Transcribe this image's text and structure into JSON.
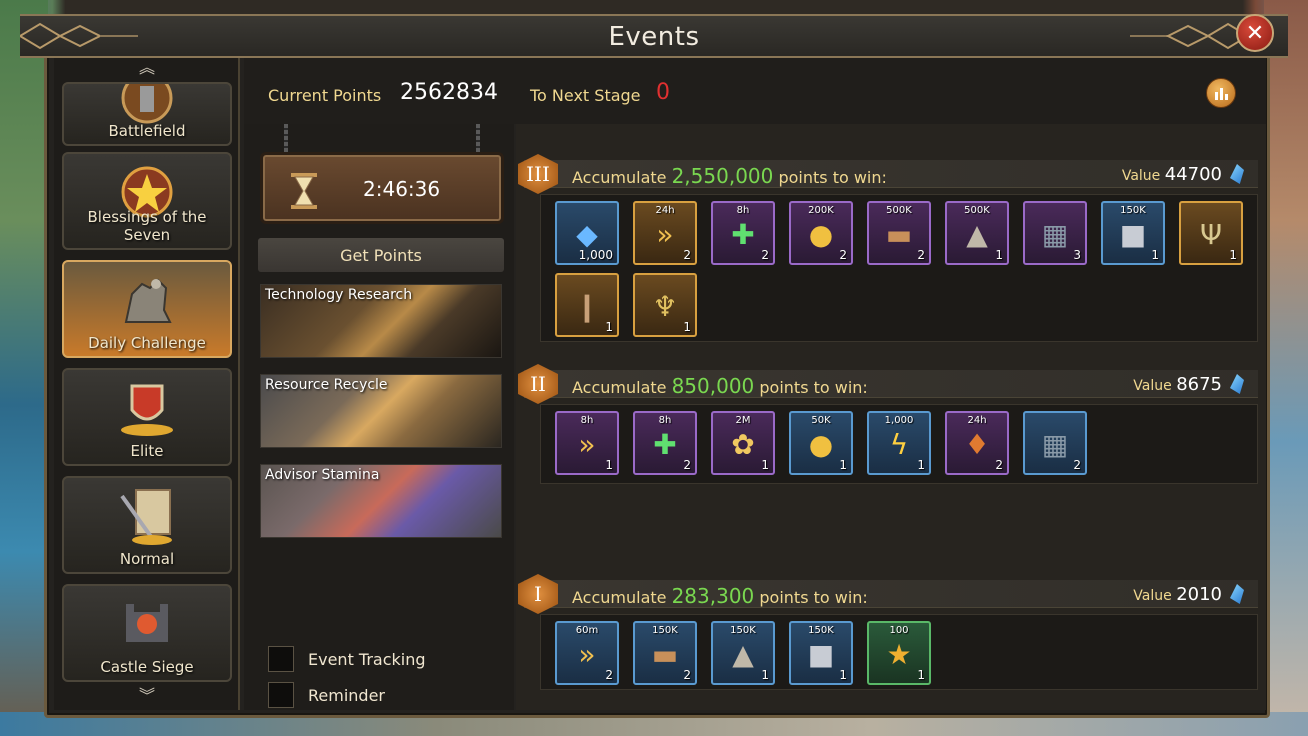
{
  "window": {
    "title": "Events"
  },
  "sidebar": {
    "items": [
      {
        "label": "Battlefield",
        "icon": "battlefield-icon",
        "active": false
      },
      {
        "label": "Blessings of the Seven",
        "icon": "blessings-icon",
        "active": false
      },
      {
        "label": "Daily Challenge",
        "icon": "knight-horse-icon",
        "active": true
      },
      {
        "label": "Elite",
        "icon": "shield-gold-icon",
        "active": false
      },
      {
        "label": "Normal",
        "icon": "scroll-sword-icon",
        "active": false
      },
      {
        "label": "Castle Siege",
        "icon": "castle-siege-icon",
        "active": false
      }
    ]
  },
  "header": {
    "current_points_label": "Current Points",
    "current_points_value": "2562834",
    "next_stage_label": "To Next Stage",
    "next_stage_value": "0"
  },
  "timer": {
    "value": "2:46:36"
  },
  "get_points": {
    "label": "Get Points",
    "sources": [
      {
        "label": "Technology Research"
      },
      {
        "label": "Resource Recycle"
      },
      {
        "label": "Advisor Stamina"
      }
    ]
  },
  "options": {
    "event_tracking": "Event Tracking",
    "reminder": "Reminder"
  },
  "tiers": [
    {
      "numeral": "III",
      "prefix": "Accumulate ",
      "points": "2,550,000",
      "suffix": " points to win:",
      "value_label": "Value",
      "value": "44700",
      "items": [
        {
          "top": "",
          "count": "1,000",
          "rarity": "blue",
          "icon": "gem-icon"
        },
        {
          "top": "24h",
          "count": "2",
          "rarity": "gold",
          "icon": "speedup-icon"
        },
        {
          "top": "8h",
          "count": "2",
          "rarity": "purple",
          "icon": "heal-potion-icon"
        },
        {
          "top": "200K",
          "count": "2",
          "rarity": "purple",
          "icon": "gold-coins-icon"
        },
        {
          "top": "500K",
          "count": "2",
          "rarity": "purple",
          "icon": "wood-icon"
        },
        {
          "top": "500K",
          "count": "1",
          "rarity": "purple",
          "icon": "stone-icon"
        },
        {
          "top": "",
          "count": "3",
          "rarity": "purple",
          "icon": "chest-icon"
        },
        {
          "top": "150K",
          "count": "1",
          "rarity": "blue",
          "icon": "iron-icon"
        },
        {
          "top": "",
          "count": "1",
          "rarity": "gold",
          "icon": "antler-frame-icon"
        },
        {
          "top": "",
          "count": "1",
          "rarity": "gold",
          "icon": "bracer-icon"
        },
        {
          "top": "",
          "count": "1",
          "rarity": "gold",
          "icon": "goblet-icon"
        }
      ]
    },
    {
      "numeral": "II",
      "prefix": "Accumulate ",
      "points": "850,000",
      "suffix": " points to win:",
      "value_label": "Value",
      "value": "8675",
      "items": [
        {
          "top": "8h",
          "count": "1",
          "rarity": "purple",
          "icon": "speedup-icon"
        },
        {
          "top": "8h",
          "count": "2",
          "rarity": "purple",
          "icon": "heal-potion-icon"
        },
        {
          "top": "2M",
          "count": "1",
          "rarity": "purple",
          "icon": "grain-icon"
        },
        {
          "top": "50K",
          "count": "1",
          "rarity": "blue",
          "icon": "gold-coins-icon"
        },
        {
          "top": "1,000",
          "count": "1",
          "rarity": "blue",
          "icon": "lightning-icon"
        },
        {
          "top": "24h",
          "count": "2",
          "rarity": "purple",
          "icon": "harvest-sack-icon"
        },
        {
          "top": "",
          "count": "2",
          "rarity": "blue",
          "icon": "chest-icon"
        }
      ]
    },
    {
      "numeral": "I",
      "prefix": "Accumulate ",
      "points": "283,300",
      "suffix": " points to win:",
      "value_label": "Value",
      "value": "2010",
      "items": [
        {
          "top": "60m",
          "count": "2",
          "rarity": "blue",
          "icon": "speedup-icon"
        },
        {
          "top": "150K",
          "count": "2",
          "rarity": "blue",
          "icon": "wood-icon"
        },
        {
          "top": "150K",
          "count": "1",
          "rarity": "blue",
          "icon": "stone-icon"
        },
        {
          "top": "150K",
          "count": "1",
          "rarity": "blue",
          "icon": "iron-icon"
        },
        {
          "top": "100",
          "count": "1",
          "rarity": "green",
          "icon": "vip-star-icon"
        }
      ]
    }
  ]
}
